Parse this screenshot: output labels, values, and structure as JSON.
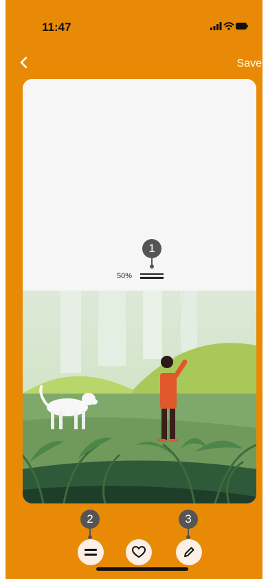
{
  "status": {
    "time": "11:47",
    "icons": [
      "signal-icon",
      "wifi-icon",
      "battery-icon"
    ]
  },
  "nav": {
    "back_icon": "chevron-left-icon",
    "save_label": "Save"
  },
  "editor": {
    "level_label": "50%"
  },
  "annotations": [
    "1",
    "2",
    "3"
  ],
  "toolbar": {
    "icons": [
      "equal-lines-icon",
      "heart-icon",
      "pencil-icon"
    ]
  },
  "colors": {
    "background": "#E98A06",
    "card_top": "#F6F6F6",
    "button_bg": "#FBEFE6",
    "badge": "#555555"
  }
}
